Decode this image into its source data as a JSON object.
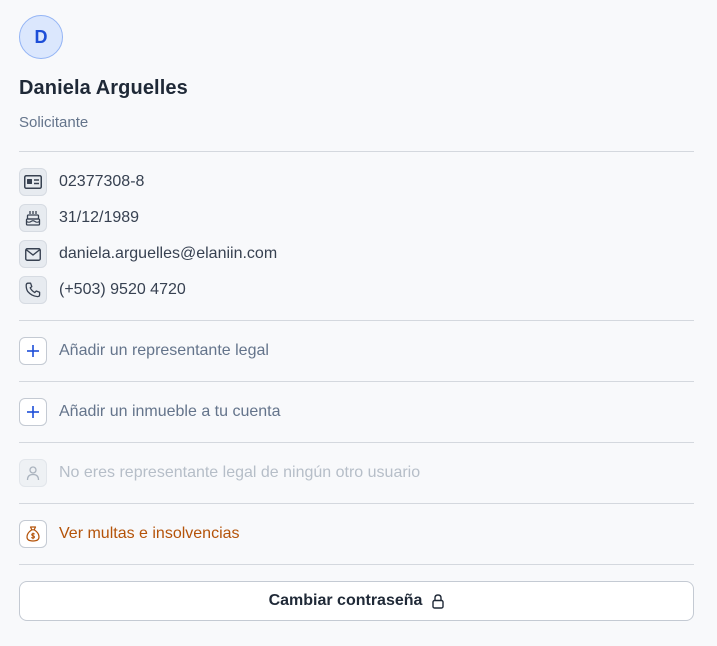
{
  "profile": {
    "initial": "D",
    "name": "Daniela Arguelles",
    "role": "Solicitante"
  },
  "details": {
    "id_number": "02377308-8",
    "birthdate": "31/12/1989",
    "email": "daniela.arguelles@elaniin.com",
    "phone": "(+503) 9520 4720"
  },
  "actions": {
    "add_legal_rep": "Añadir un representante legal",
    "add_property": "Añadir un inmueble a tu cuenta",
    "no_legal_rep": "No eres representante legal de ningún otro usuario",
    "view_fines": "Ver multas e insolvencias"
  },
  "buttons": {
    "change_password": "Cambiar contraseña"
  },
  "colors": {
    "accent": "#1d4ed8",
    "warning": "#b45309",
    "avatar_bg": "#dbe7fd"
  },
  "icons": {
    "id": "id-card-icon",
    "birthday": "cake-icon",
    "email": "mail-icon",
    "phone": "phone-icon",
    "add": "plus-icon",
    "user": "user-icon",
    "money": "money-bag-icon",
    "lock": "lock-icon"
  }
}
